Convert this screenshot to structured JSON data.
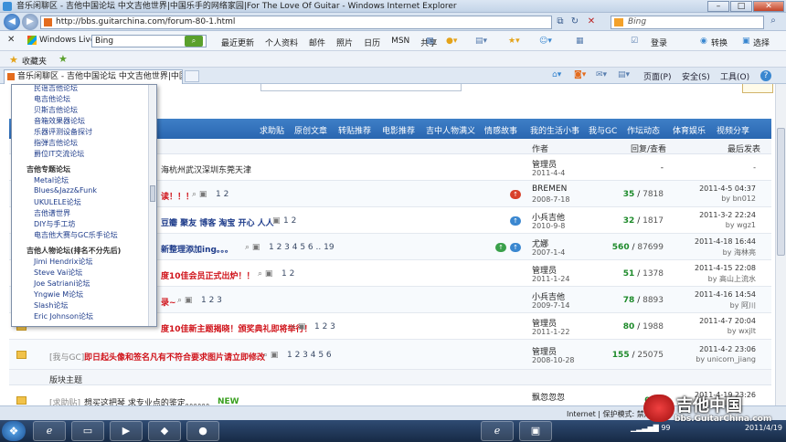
{
  "window": {
    "title": "音乐闲聊区 - 吉他中国论坛 中文吉他世界|中国乐手的网络家园|For The Love Of Guitar - Windows Internet Explorer"
  },
  "address": {
    "url": "http://bbs.guitarchina.com/forum-80-1.html",
    "search_placeholder": "Bing"
  },
  "livebar": {
    "brand": "Windows Live",
    "search_value": "Bing",
    "menu": [
      "最近更新",
      "个人资料",
      "邮件",
      "照片",
      "日历",
      "MSN",
      "共享"
    ],
    "login": "登录",
    "convert": "转换",
    "select": "选择"
  },
  "favorites": {
    "label": "收藏夹"
  },
  "tab": {
    "label": "音乐闲聊区 - 吉他中国论坛 中文吉他世界|中国乐手..."
  },
  "commands": {
    "page": "页面(P)",
    "safety": "安全(S)",
    "tools": "工具(O)",
    "help": "?"
  },
  "forumnav": [
    "求助贴",
    "原创文章",
    "转贴推荐",
    "电影推荐",
    "吉中人物满义",
    "情感故事",
    "我的生活小事",
    "我与GC",
    "作坛动态",
    "体育娱乐",
    "视频分享"
  ],
  "header": {
    "author": "作者",
    "stats": "回复/查看",
    "last": "最后发表"
  },
  "rows": [
    {
      "title": "海杭州武汉深圳东莞天津",
      "author": "管理员",
      "date": "2011-4-4",
      "replies": "-",
      "views": "",
      "last_date": "-",
      "last_by": ""
    },
    {
      "title": "读！！！",
      "pages": "1 2",
      "author": "BREMEN",
      "date": "2008-7-18",
      "replies": "35",
      "views": "7818",
      "last_date": "2011-4-5 04:37",
      "last_by": "by bn012"
    },
    {
      "title": "豆瓣 聚友 博客 淘宝 开心 人人",
      "pages": "1 2",
      "author": "小兵吉他",
      "date": "2010-9-8",
      "replies": "32",
      "views": "1817",
      "last_date": "2011-3-2 22:24",
      "last_by": "by wgz1"
    },
    {
      "title": "新整理添加ing。。。",
      "pages": "1 2 3 4 5 6 .. 19",
      "author": "尤娜",
      "date": "2007-1-4",
      "replies": "560",
      "views": "87699",
      "last_date": "2011-4-18 16:44",
      "last_by": "by 海林亮"
    },
    {
      "title": "度10佳会员正式出炉！！",
      "pages": "1 2",
      "author": "管理员",
      "date": "2011-1-24",
      "replies": "51",
      "views": "1378",
      "last_date": "2011-4-15 22:08",
      "last_by": "by 高山上流水"
    },
    {
      "title": "录~",
      "pages": "1 2 3",
      "author": "小兵吉他",
      "date": "2009-7-14",
      "replies": "78",
      "views": "8893",
      "last_date": "2011-4-16 14:54",
      "last_by": "by 阿川"
    },
    {
      "title": "度10佳新主题揭晓！颁奖典礼即将举行！",
      "pages": "1 2 3",
      "author": "管理员",
      "date": "2011-1-22",
      "replies": "80",
      "views": "1988",
      "last_date": "2011-4-7 20:04",
      "last_by": "by wxjlt"
    },
    {
      "prefix": "[我与GC]",
      "title": "即日起头像和签名凡有不符合要求图片请立即修改",
      "pages": "1 2 3 4 5 6",
      "author": "管理员",
      "date": "2008-10-28",
      "replies": "155",
      "views": "25075",
      "last_date": "2011-4-2 23:06",
      "last_by": "by unicorn_jiang"
    }
  ],
  "section": {
    "label": "版块主题"
  },
  "last_row": {
    "prefix": "[求助贴]",
    "title": "想买这把琴 求专业点的鉴定。。。。。。",
    "new": "NEW",
    "author": "飘忽忽忽",
    "replies": "0",
    "views": "0",
    "last_date": "2011-4-19 23:26"
  },
  "dropdown": {
    "items": [
      {
        "t": "item",
        "text": "民谣吉他论坛"
      },
      {
        "t": "item",
        "text": "电吉他论坛"
      },
      {
        "t": "item",
        "text": "贝斯吉他论坛"
      },
      {
        "t": "item",
        "text": "音箱效果器论坛"
      },
      {
        "t": "item",
        "text": "乐器评测设备探讨"
      },
      {
        "t": "item",
        "text": "指弹吉他论坛"
      },
      {
        "t": "item",
        "text": "爵位IT交流论坛"
      },
      {
        "t": "grp",
        "text": "吉他专题论坛"
      },
      {
        "t": "item",
        "text": "Metal论坛"
      },
      {
        "t": "item",
        "text": "Blues&Jazz&Funk"
      },
      {
        "t": "item",
        "text": "UKULELE论坛"
      },
      {
        "t": "item",
        "text": "吉他谱世界"
      },
      {
        "t": "item",
        "text": "DIY与手工坊"
      },
      {
        "t": "item",
        "text": "电吉他大赛与GC乐手论坛"
      },
      {
        "t": "grp",
        "text": "吉他人物论坛(排名不分先后)"
      },
      {
        "t": "item",
        "text": "Jimi Hendrix论坛"
      },
      {
        "t": "item",
        "text": "Steve Vai论坛"
      },
      {
        "t": "item",
        "text": "Joe Satriani论坛"
      },
      {
        "t": "item",
        "text": "Yngwie M论坛"
      },
      {
        "t": "item",
        "text": "Slash论坛"
      },
      {
        "t": "item",
        "text": "Eric Johnson论坛"
      }
    ]
  },
  "status": {
    "zone": "Internet | 保护模式: 禁用"
  },
  "watermark": {
    "big": "吉他中国",
    "small": "bbs.GuitarChina.com"
  },
  "clock": {
    "date": "2011/4/19"
  },
  "tray": {
    "battery": "99"
  }
}
